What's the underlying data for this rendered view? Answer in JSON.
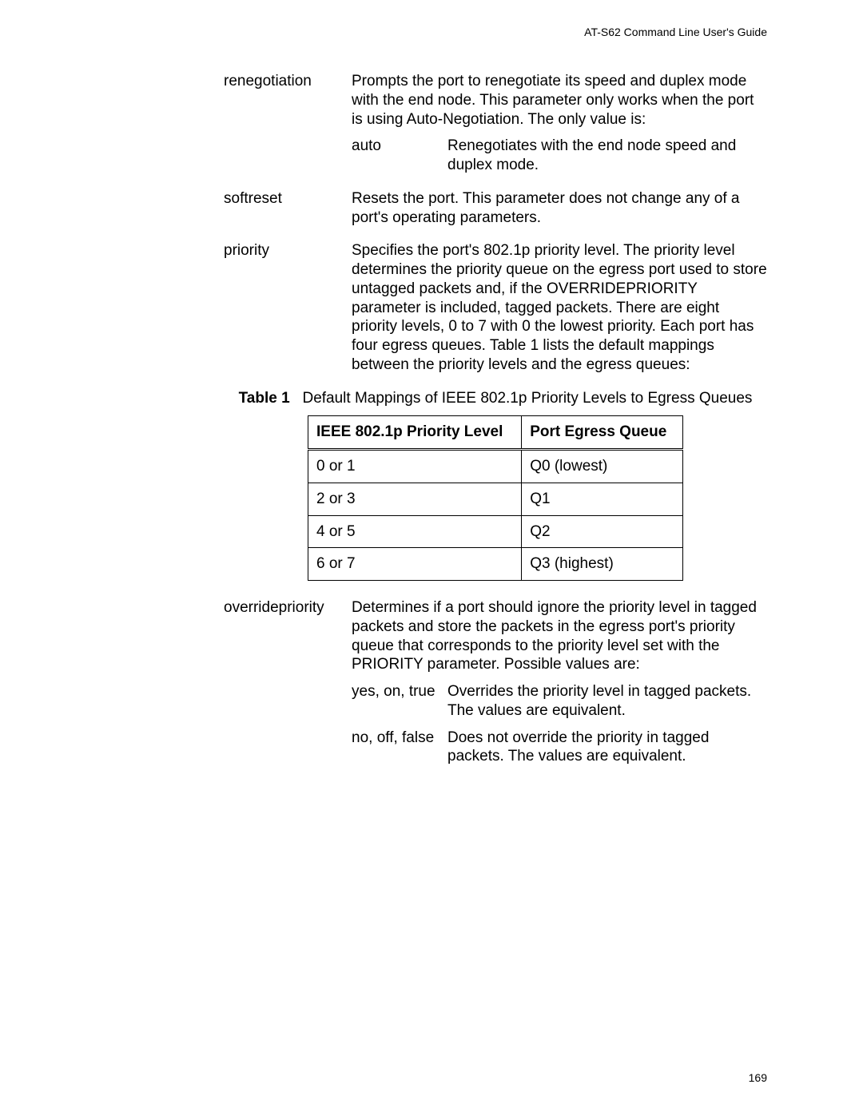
{
  "header": "AT-S62 Command Line User's Guide",
  "page_number": "169",
  "defs": {
    "renegotiation": {
      "term": "renegotiation",
      "desc": "Prompts the port to renegotiate its speed and duplex mode with the end node. This parameter only works when the port is using Auto-Negotiation. The only value is:",
      "sub": {
        "auto": {
          "key": "auto",
          "val": "Renegotiates with the end node speed and duplex mode."
        }
      }
    },
    "softreset": {
      "term": "softreset",
      "desc": "Resets the port. This parameter does not change any of a port's operating parameters."
    },
    "priority": {
      "term": "priority",
      "desc": "Specifies the port's 802.1p priority level. The priority level determines the priority queue on the egress port used to store untagged packets and, if the OVERRIDEPRIORITY parameter is included, tagged packets. There are eight priority levels, 0 to 7 with 0 the lowest priority. Each port has four egress queues. Table 1 lists the default mappings between the priority levels and the egress queues:"
    },
    "overridepriority": {
      "term": "overridepriority",
      "desc": "Determines if a port should ignore the priority level in tagged packets and store the packets in the egress port's priority queue that corresponds to the priority level set with the PRIORITY parameter. Possible values are:",
      "sub": {
        "yes": {
          "key": "yes, on, true",
          "val": "Overrides the priority level in tagged packets. The values are equivalent."
        },
        "no": {
          "key": "no, off, false",
          "val": "Does not override the priority in tagged packets. The values are equivalent."
        }
      }
    }
  },
  "table": {
    "label": "Table 1",
    "caption": "Default Mappings of IEEE 802.1p Priority Levels to Egress Queues",
    "headers": {
      "c1": "IEEE 802.1p Priority Level",
      "c2": "Port Egress Queue"
    },
    "rows": [
      {
        "c1": "0 or 1",
        "c2": "Q0 (lowest)"
      },
      {
        "c1": "2 or 3",
        "c2": "Q1"
      },
      {
        "c1": "4 or 5",
        "c2": "Q2"
      },
      {
        "c1": "6 or 7",
        "c2": "Q3 (highest)"
      }
    ]
  }
}
